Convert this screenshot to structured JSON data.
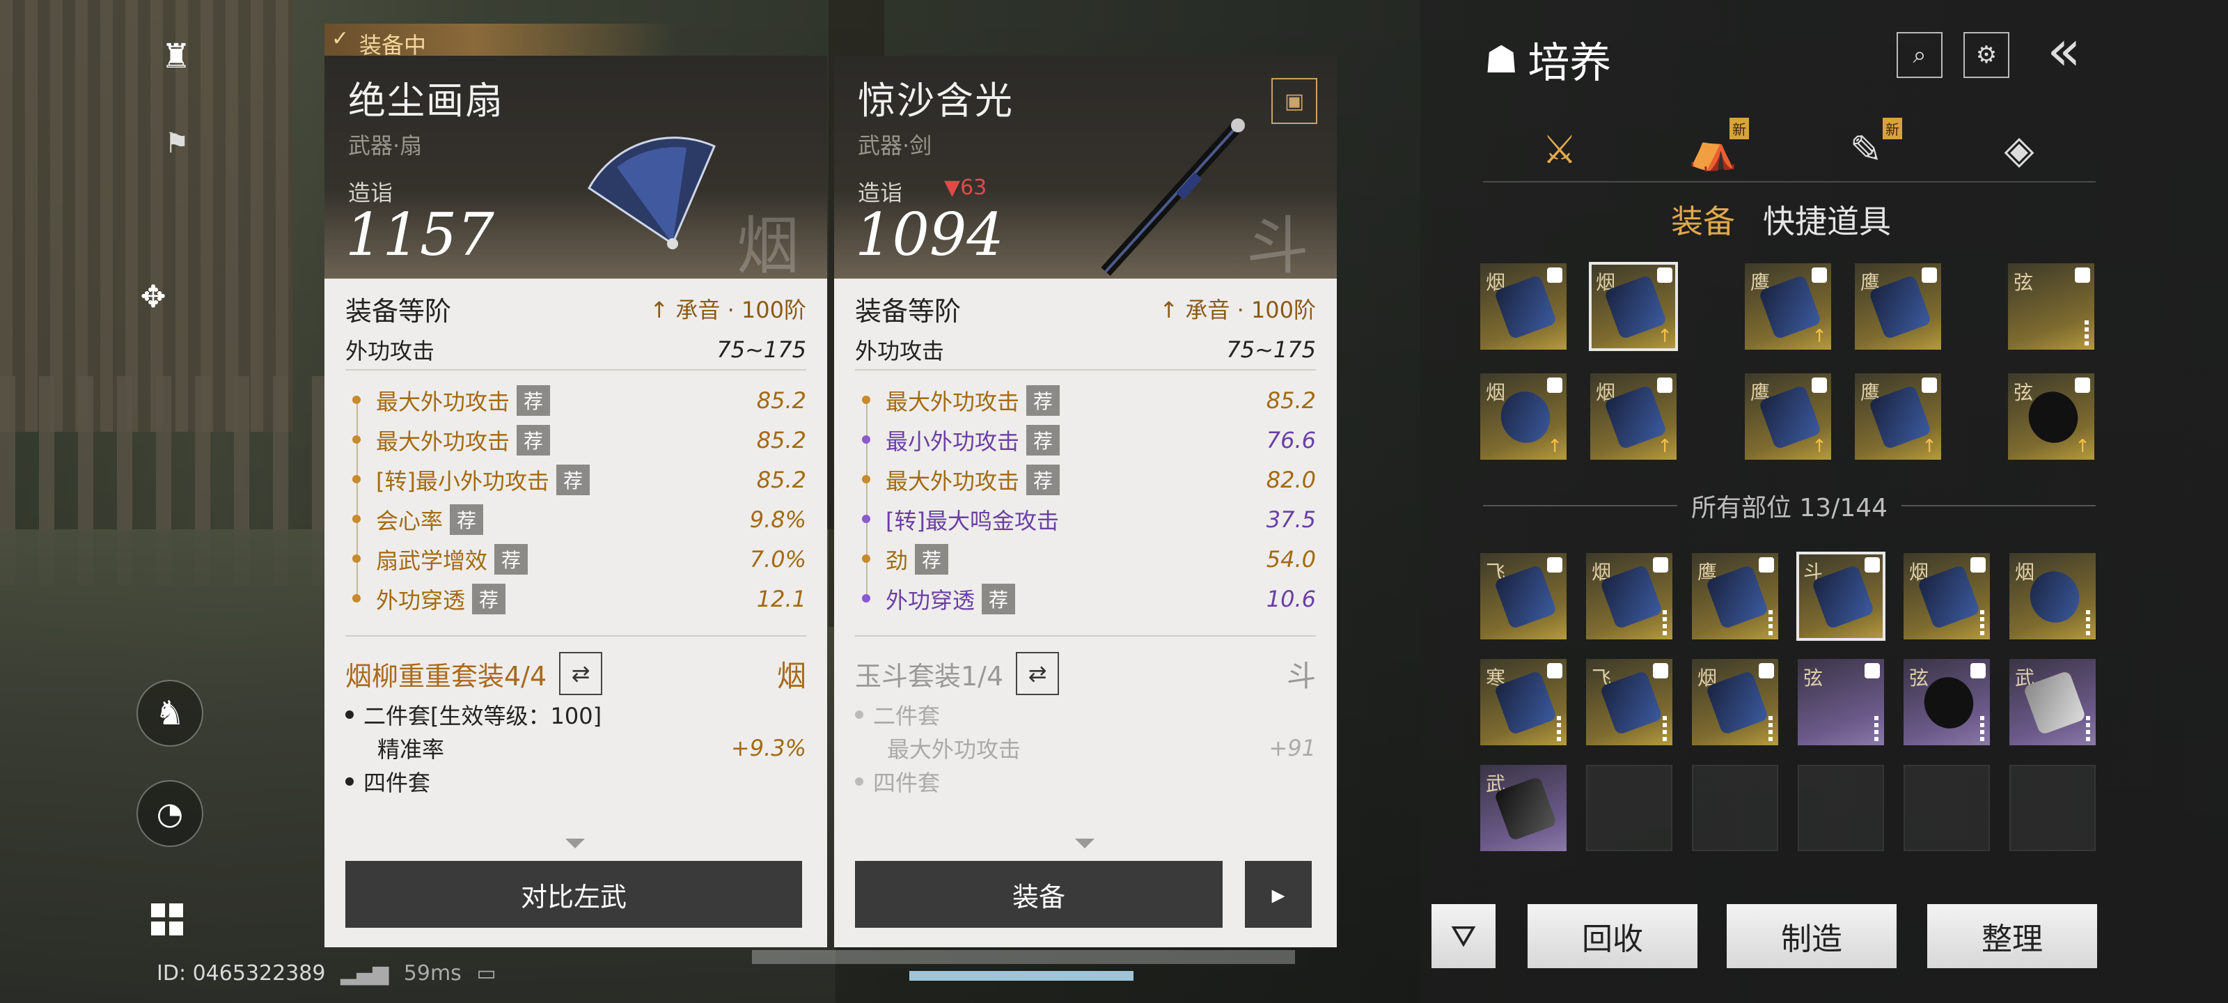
{
  "hud": {
    "id_text": "ID: 0465322389",
    "ping": "59ms"
  },
  "left_card": {
    "equipped_label": "装备中",
    "name": "绝尘画扇",
    "type": "武器·扇",
    "zaoyi_label": "造诣",
    "zaoyi_value": "1157",
    "watermark": "烟",
    "tier_label": "装备等阶",
    "tier_value": "承音 · 100阶",
    "base_stat_label": "外功攻击",
    "base_stat_value": "75~175",
    "attrs": [
      {
        "label": "最大外功攻击",
        "tag": "荐",
        "value": "85.2",
        "color": "gold"
      },
      {
        "label": "最大外功攻击",
        "tag": "荐",
        "value": "85.2",
        "color": "gold"
      },
      {
        "label": "[转]最小外功攻击",
        "tag": "荐",
        "value": "85.2",
        "color": "gold"
      },
      {
        "label": "会心率",
        "tag": "荐",
        "value": "9.8%",
        "color": "gold"
      },
      {
        "label": "扇武学增效",
        "tag": "荐",
        "value": "7.0%",
        "color": "gold"
      },
      {
        "label": "外功穿透",
        "tag": "荐",
        "value": "12.1",
        "color": "gold"
      }
    ],
    "set_name": "烟柳重重套装4/4",
    "set_mark": "烟",
    "set_items": [
      {
        "text": "二件套[生效等级：100]",
        "value": ""
      },
      {
        "text": "精准率",
        "value": "+9.3%"
      },
      {
        "text": "四件套",
        "value": ""
      }
    ],
    "button": "对比左武"
  },
  "right_card": {
    "name": "惊沙含光",
    "type": "武器·剑",
    "zaoyi_label": "造诣",
    "zaoyi_diff": "▼63",
    "zaoyi_value": "1094",
    "watermark": "斗",
    "tier_label": "装备等阶",
    "tier_value": "承音 · 100阶",
    "base_stat_label": "外功攻击",
    "base_stat_value": "75~175",
    "attrs": [
      {
        "label": "最大外功攻击",
        "tag": "荐",
        "value": "85.2",
        "color": "gold"
      },
      {
        "label": "最小外功攻击",
        "tag": "荐",
        "value": "76.6",
        "color": "purple"
      },
      {
        "label": "最大外功攻击",
        "tag": "荐",
        "value": "82.0",
        "color": "gold"
      },
      {
        "label": "[转]最大鸣金攻击",
        "tag": "",
        "value": "37.5",
        "color": "purple"
      },
      {
        "label": "劲",
        "tag": "荐",
        "value": "54.0",
        "color": "gold"
      },
      {
        "label": "外功穿透",
        "tag": "荐",
        "value": "10.6",
        "color": "purple"
      }
    ],
    "set_name": "玉斗套装1/4",
    "set_mark": "斗",
    "set_items": [
      {
        "text": "二件套",
        "value": ""
      },
      {
        "text": "最大外功攻击",
        "value": "+91"
      },
      {
        "text": "四件套",
        "value": ""
      }
    ],
    "button": "装备"
  },
  "panel": {
    "title": "培养",
    "new_badge": "新",
    "tab_equip": "装备",
    "tab_items": "快捷道具",
    "all_slots": "所有部位 13/144",
    "btn_recycle": "回收",
    "btn_craft": "制造",
    "btn_sort": "整理"
  },
  "grid_top": [
    {
      "ch": "烟",
      "kind": "gold"
    },
    {
      "ch": "烟",
      "kind": "gold",
      "selected": true
    },
    {
      "ch": "鹰",
      "kind": "gold"
    },
    {
      "ch": "鹰",
      "kind": "gold"
    },
    {
      "ch": "弦",
      "kind": "gold"
    },
    {
      "ch": "烟",
      "kind": "gold"
    },
    {
      "ch": "烟",
      "kind": "gold"
    },
    {
      "ch": "鹰",
      "kind": "gold"
    },
    {
      "ch": "鹰",
      "kind": "gold"
    },
    {
      "ch": "弦",
      "kind": "gold"
    }
  ],
  "grid_all": [
    {
      "ch": "飞",
      "kind": "gold"
    },
    {
      "ch": "烟",
      "kind": "gold"
    },
    {
      "ch": "鹰",
      "kind": "gold"
    },
    {
      "ch": "斗",
      "kind": "gold",
      "selected": true
    },
    {
      "ch": "烟",
      "kind": "gold"
    },
    {
      "ch": "烟",
      "kind": "gold"
    },
    {
      "ch": "寒",
      "kind": "gold"
    },
    {
      "ch": "飞",
      "kind": "gold"
    },
    {
      "ch": "烟",
      "kind": "gold"
    },
    {
      "ch": "弦",
      "kind": "purp"
    },
    {
      "ch": "弦",
      "kind": "purp"
    },
    {
      "ch": "武",
      "kind": "purp"
    },
    {
      "ch": "武",
      "kind": "purp"
    }
  ]
}
